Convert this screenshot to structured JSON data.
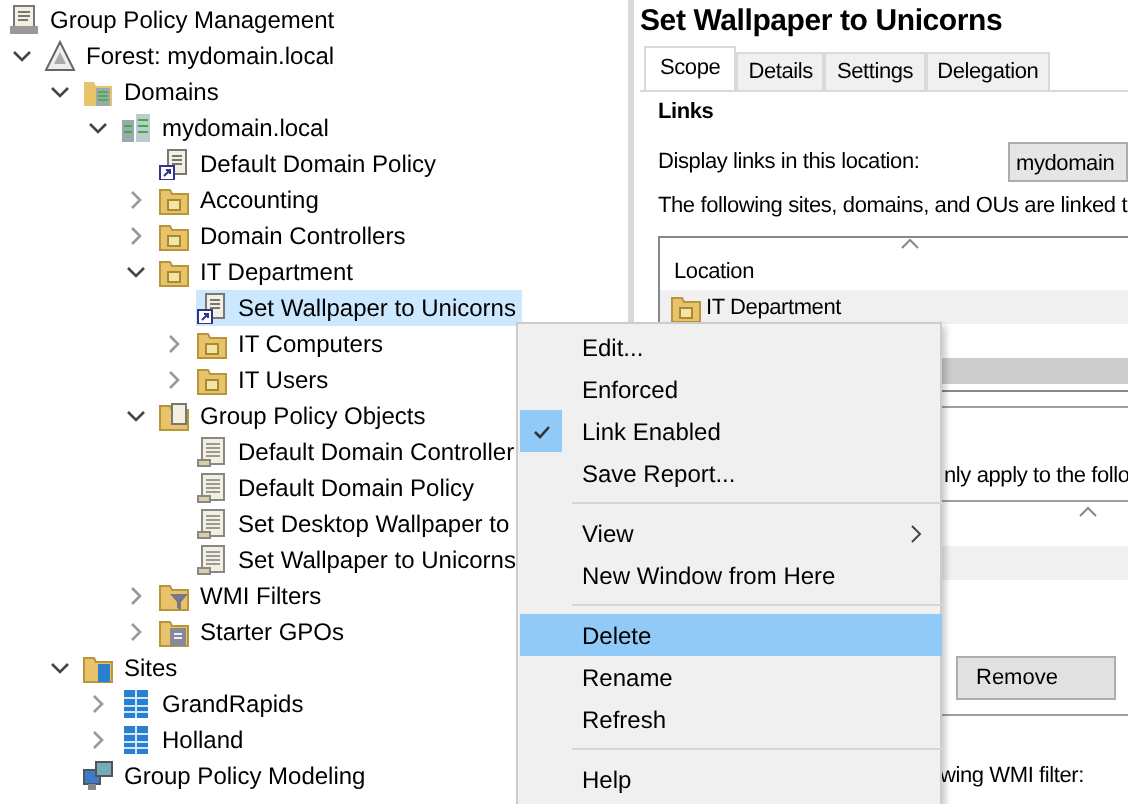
{
  "tree": {
    "label": "Group Policy Management",
    "kind": "root",
    "selected": false,
    "children": [
      {
        "label": "Forest: mydomain.local",
        "kind": "forest",
        "expanded": true,
        "selected": false,
        "children": [
          {
            "label": "Domains",
            "kind": "domains",
            "expanded": true,
            "selected": false,
            "children": [
              {
                "label": "mydomain.local",
                "kind": "domain",
                "expanded": true,
                "selected": false,
                "children": [
                  {
                    "label": "Default Domain Policy",
                    "kind": "gpo-link",
                    "selected": false
                  },
                  {
                    "label": "Accounting",
                    "kind": "ou",
                    "expanded": false,
                    "selected": false
                  },
                  {
                    "label": "Domain Controllers",
                    "kind": "ou",
                    "expanded": false,
                    "selected": false
                  },
                  {
                    "label": "IT Department",
                    "kind": "ou",
                    "expanded": true,
                    "selected": false,
                    "children": [
                      {
                        "label": "Set Wallpaper to Unicorns",
                        "kind": "gpo-link",
                        "selected": true
                      },
                      {
                        "label": "IT Computers",
                        "kind": "ou",
                        "expanded": false,
                        "selected": false
                      },
                      {
                        "label": "IT Users",
                        "kind": "ou",
                        "expanded": false,
                        "selected": false
                      }
                    ]
                  },
                  {
                    "label": "Group Policy Objects",
                    "kind": "gpo-folder",
                    "expanded": true,
                    "selected": false,
                    "children": [
                      {
                        "label": "Default Domain Controller",
                        "kind": "gpo",
                        "selected": false
                      },
                      {
                        "label": "Default Domain Policy",
                        "kind": "gpo",
                        "selected": false
                      },
                      {
                        "label": "Set Desktop Wallpaper to",
                        "kind": "gpo",
                        "selected": false
                      },
                      {
                        "label": "Set Wallpaper to Unicorns",
                        "kind": "gpo",
                        "selected": false
                      }
                    ]
                  },
                  {
                    "label": "WMI Filters",
                    "kind": "wmi",
                    "expanded": false,
                    "selected": false
                  },
                  {
                    "label": "Starter GPOs",
                    "kind": "starter",
                    "expanded": false,
                    "selected": false
                  }
                ]
              }
            ]
          },
          {
            "label": "Sites",
            "kind": "sites",
            "expanded": true,
            "selected": false,
            "children": [
              {
                "label": "GrandRapids",
                "kind": "site",
                "expanded": false,
                "selected": false
              },
              {
                "label": "Holland",
                "kind": "site",
                "expanded": false,
                "selected": false
              }
            ]
          },
          {
            "label": "Group Policy Modeling",
            "kind": "modeling",
            "selected": false
          }
        ]
      }
    ]
  },
  "details": {
    "title": "Set Wallpaper to Unicorns",
    "tabs": [
      {
        "label": "Scope",
        "selected": true
      },
      {
        "label": "Details",
        "selected": false
      },
      {
        "label": "Settings",
        "selected": false
      },
      {
        "label": "Delegation",
        "selected": false
      }
    ],
    "links_heading": "Links",
    "display_label": "Display links in this location:",
    "location_dropdown": "mydomain",
    "linked_text": "The following sites, domains, and OUs are linked t",
    "links_table": {
      "column_header": "Location",
      "rows": [
        {
          "label": "IT Department"
        }
      ]
    },
    "filter_text": "nly apply to the follo",
    "remove_button": "Remove",
    "wmi_text": "wing WMI filter:"
  },
  "context_menu": {
    "items": [
      {
        "kind": "item",
        "label": "Edit...",
        "checked": false,
        "selected": false
      },
      {
        "kind": "item",
        "label": "Enforced",
        "checked": false,
        "selected": false
      },
      {
        "kind": "item",
        "label": "Link Enabled",
        "checked": true,
        "selected": false
      },
      {
        "kind": "item",
        "label": "Save Report...",
        "checked": false,
        "selected": false
      },
      {
        "kind": "separator"
      },
      {
        "kind": "submenu",
        "label": "View",
        "checked": false,
        "selected": false
      },
      {
        "kind": "item",
        "label": "New Window from Here",
        "checked": false,
        "selected": false
      },
      {
        "kind": "separator"
      },
      {
        "kind": "item",
        "label": "Delete",
        "checked": false,
        "selected": true
      },
      {
        "kind": "item",
        "label": "Rename",
        "checked": false,
        "selected": false
      },
      {
        "kind": "item",
        "label": "Refresh",
        "checked": false,
        "selected": false
      },
      {
        "kind": "separator"
      },
      {
        "kind": "item",
        "label": "Help",
        "checked": false,
        "selected": false
      }
    ]
  }
}
